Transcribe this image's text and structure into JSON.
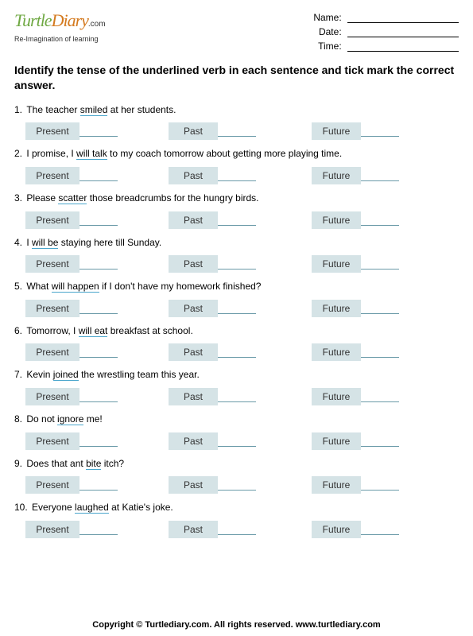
{
  "logo": {
    "turtle": "Turtle",
    "diary": "Diary",
    "dotcom": ".com",
    "tagline": "Re-Imagination of learning"
  },
  "info": {
    "name_label": "Name:",
    "date_label": "Date:",
    "time_label": "Time:"
  },
  "instructions": "Identify the tense of the underlined verb in each sentence and tick mark the correct answer.",
  "option_labels": {
    "present": "Present",
    "past": "Past",
    "future": "Future"
  },
  "questions": [
    {
      "n": "1.",
      "before": "The teacher ",
      "u": "smiled",
      "after": " at her students."
    },
    {
      "n": "2.",
      "before": "I promise, I ",
      "u": "will talk",
      "after": " to my coach tomorrow about getting more playing time."
    },
    {
      "n": "3.",
      "before": "Please ",
      "u": "scatter",
      "after": " those breadcrumbs for the hungry birds."
    },
    {
      "n": "4.",
      "before": "I ",
      "u": "will be",
      "after": " staying here till Sunday."
    },
    {
      "n": "5.",
      "before": "What ",
      "u": "will happen",
      "after": " if I don't have my homework finished?"
    },
    {
      "n": "6.",
      "before": "Tomorrow, I ",
      "u": "will eat",
      "after": " breakfast at school."
    },
    {
      "n": "7.",
      "before": "Kevin ",
      "u": "joined",
      "after": " the wrestling team this year."
    },
    {
      "n": "8.",
      "before": "Do not ",
      "u": "ignore",
      "after": " me!"
    },
    {
      "n": "9.",
      "before": "Does that ant ",
      "u": "bite",
      "after": " itch?"
    },
    {
      "n": "10.",
      "before": "Everyone ",
      "u": "laughed",
      "after": " at Katie's joke."
    }
  ],
  "footer": "Copyright © Turtlediary.com. All rights reserved. www.turtlediary.com"
}
